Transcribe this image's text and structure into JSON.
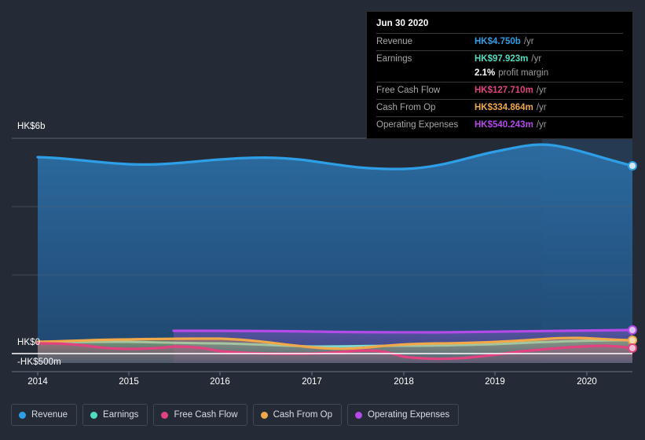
{
  "background_color": "#252b36",
  "tooltip": {
    "date": "Jun 30 2020",
    "rows": [
      {
        "key": "Revenue",
        "value": "HK$4.750b",
        "unit": "/yr",
        "color": "#2e9fe6"
      },
      {
        "key": "Earnings",
        "value": "HK$97.923m",
        "unit": "/yr",
        "color": "#4fdcc0"
      },
      {
        "key": "Free Cash Flow",
        "value": "HK$127.710m",
        "unit": "/yr",
        "color": "#e0437f"
      },
      {
        "key": "Cash From Op",
        "value": "HK$334.864m",
        "unit": "/yr",
        "color": "#f0a84a"
      },
      {
        "key": "Operating Expenses",
        "value": "HK$540.243m",
        "unit": "/yr",
        "color": "#b44ae8"
      }
    ],
    "profit_margin_value": "2.1%",
    "profit_margin_label": "profit margin"
  },
  "legend": {
    "items": [
      {
        "label": "Revenue",
        "color": "#2e9fe6"
      },
      {
        "label": "Earnings",
        "color": "#4fdcc0"
      },
      {
        "label": "Free Cash Flow",
        "color": "#e0437f"
      },
      {
        "label": "Cash From Op",
        "color": "#f0a84a"
      },
      {
        "label": "Operating Expenses",
        "color": "#b44ae8"
      }
    ]
  },
  "axes": {
    "y_top_label": "HK$6b",
    "y_zero_label": "HK$0",
    "y_bottom_label": "-HK$500m",
    "x_labels": [
      "2014",
      "2015",
      "2016",
      "2017",
      "2018",
      "2019",
      "2020"
    ]
  },
  "chart_data": {
    "type": "area",
    "title": "",
    "xlabel": "",
    "ylabel": "",
    "ylim": [
      -500000000,
      6000000000
    ],
    "y_ticks": [
      "HK$6b",
      "HK$0",
      "-HK$500m"
    ],
    "grid": true,
    "legend_position": "bottom-left",
    "x": [
      "2014",
      "2015",
      "2016",
      "2017",
      "2018",
      "2019",
      "2020"
    ],
    "currency": "HKD",
    "series": [
      {
        "name": "Revenue",
        "color": "#2e9fe6",
        "values": [
          5150,
          5020,
          5060,
          4880,
          4760,
          4840,
          5270,
          4750
        ],
        "unit": "HK$m"
      },
      {
        "name": "Earnings",
        "color": "#4fdcc0",
        "values": [
          55,
          60,
          25,
          -30,
          -20,
          40,
          120,
          98
        ],
        "unit": "HK$m"
      },
      {
        "name": "Free Cash Flow",
        "color": "#e0437f",
        "values": [
          20,
          -90,
          -200,
          -250,
          -330,
          -240,
          -60,
          128
        ],
        "unit": "HK$m"
      },
      {
        "name": "Cash From Op",
        "color": "#f0a84a",
        "values": [
          120,
          150,
          170,
          -20,
          30,
          80,
          270,
          335
        ],
        "unit": "HK$m"
      },
      {
        "name": "Operating Expenses",
        "color": "#b44ae8",
        "values": [
          null,
          450,
          460,
          470,
          480,
          500,
          530,
          540
        ],
        "unit": "HK$m"
      }
    ],
    "highlight_band": {
      "from": "2019.7",
      "to": "2020.5"
    }
  }
}
